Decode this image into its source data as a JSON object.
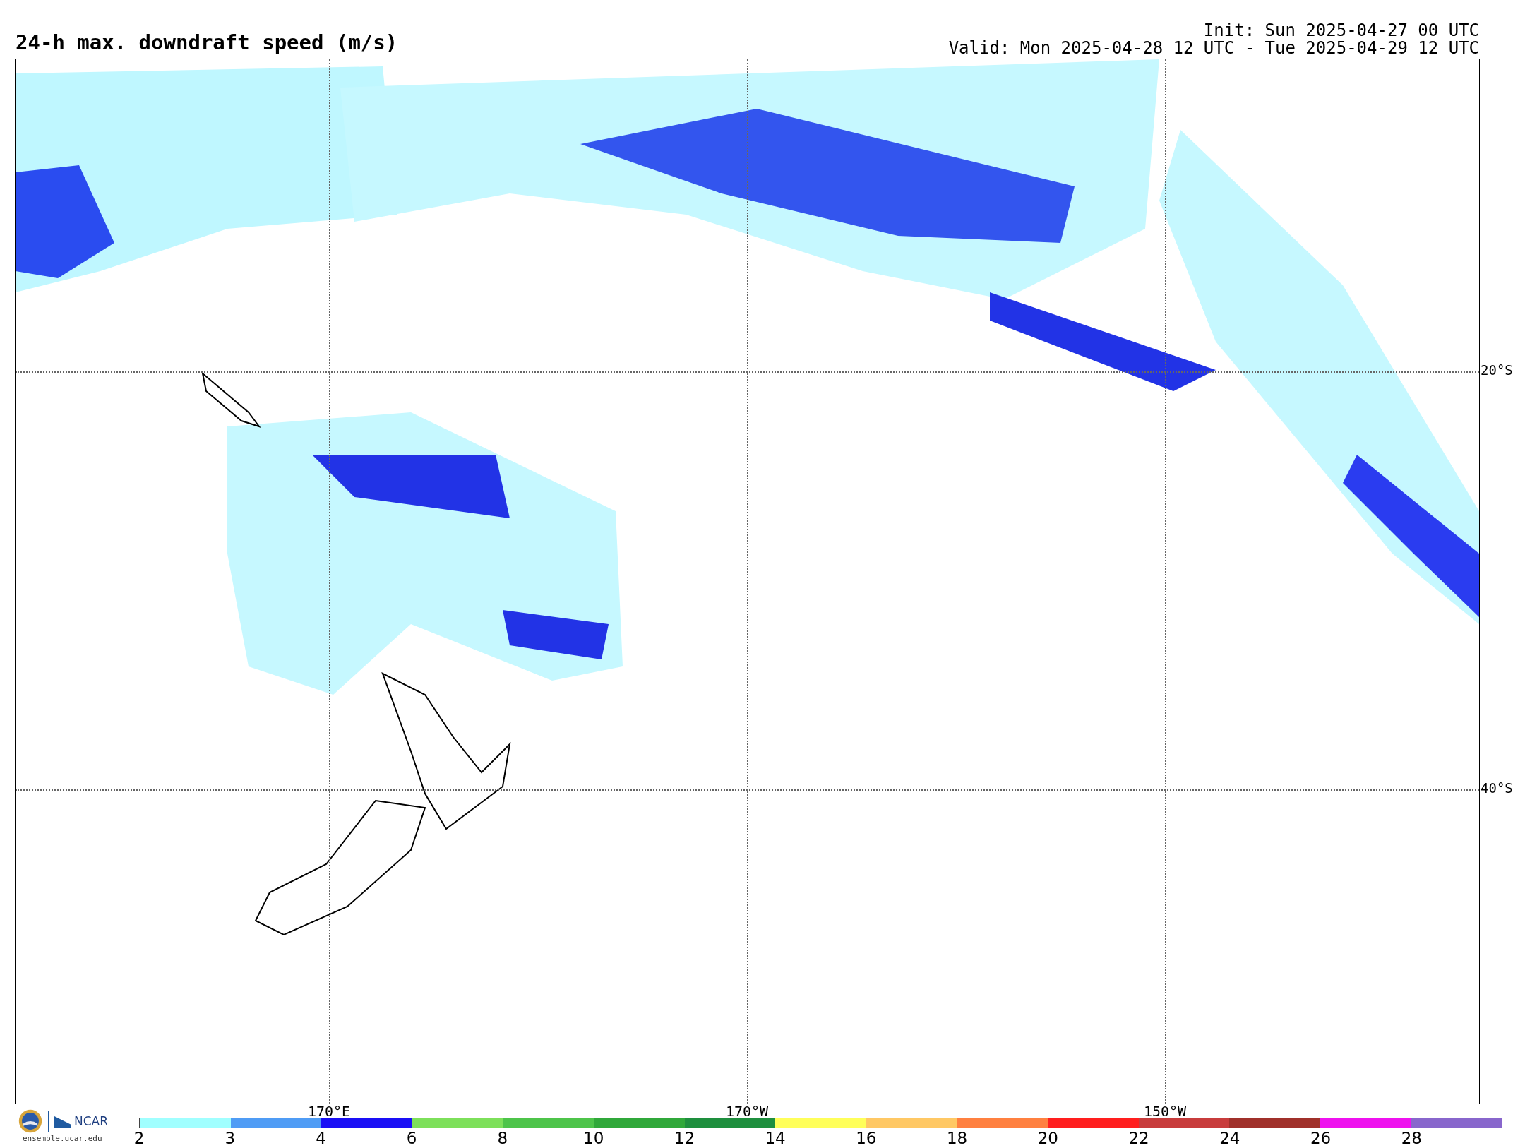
{
  "title": "24-h max. downdraft speed (m/s)",
  "init": "Init: Sun 2025-04-27 00 UTC",
  "valid": "Valid: Mon 2025-04-28 12 UTC - Tue 2025-04-29 12 UTC",
  "map": {
    "lat_labels": [
      "20°S",
      "40°S"
    ],
    "lon_labels": [
      "170°E",
      "170°W",
      "150°W"
    ]
  },
  "logos": {
    "org": "NCAR",
    "site": "ensemble.ucar.edu"
  },
  "legend": {
    "bins": [
      {
        "color": "#a0ffff"
      },
      {
        "color": "#4f9cf5"
      },
      {
        "color": "#1a0ff5"
      },
      {
        "color": "#7de05a"
      },
      {
        "color": "#4dc44a"
      },
      {
        "color": "#30a83a"
      },
      {
        "color": "#1e8f3e"
      },
      {
        "color": "#ffff5a"
      },
      {
        "color": "#ffc864"
      },
      {
        "color": "#ff8040"
      },
      {
        "color": "#ff1e1e"
      },
      {
        "color": "#c83c3c"
      },
      {
        "color": "#a0302a"
      },
      {
        "color": "#ee11ee"
      },
      {
        "color": "#8866cc"
      }
    ],
    "labels": [
      "2",
      "3",
      "4",
      "6",
      "8",
      "10",
      "12",
      "14",
      "16",
      "18",
      "20",
      "22",
      "24",
      "26",
      "28"
    ]
  }
}
